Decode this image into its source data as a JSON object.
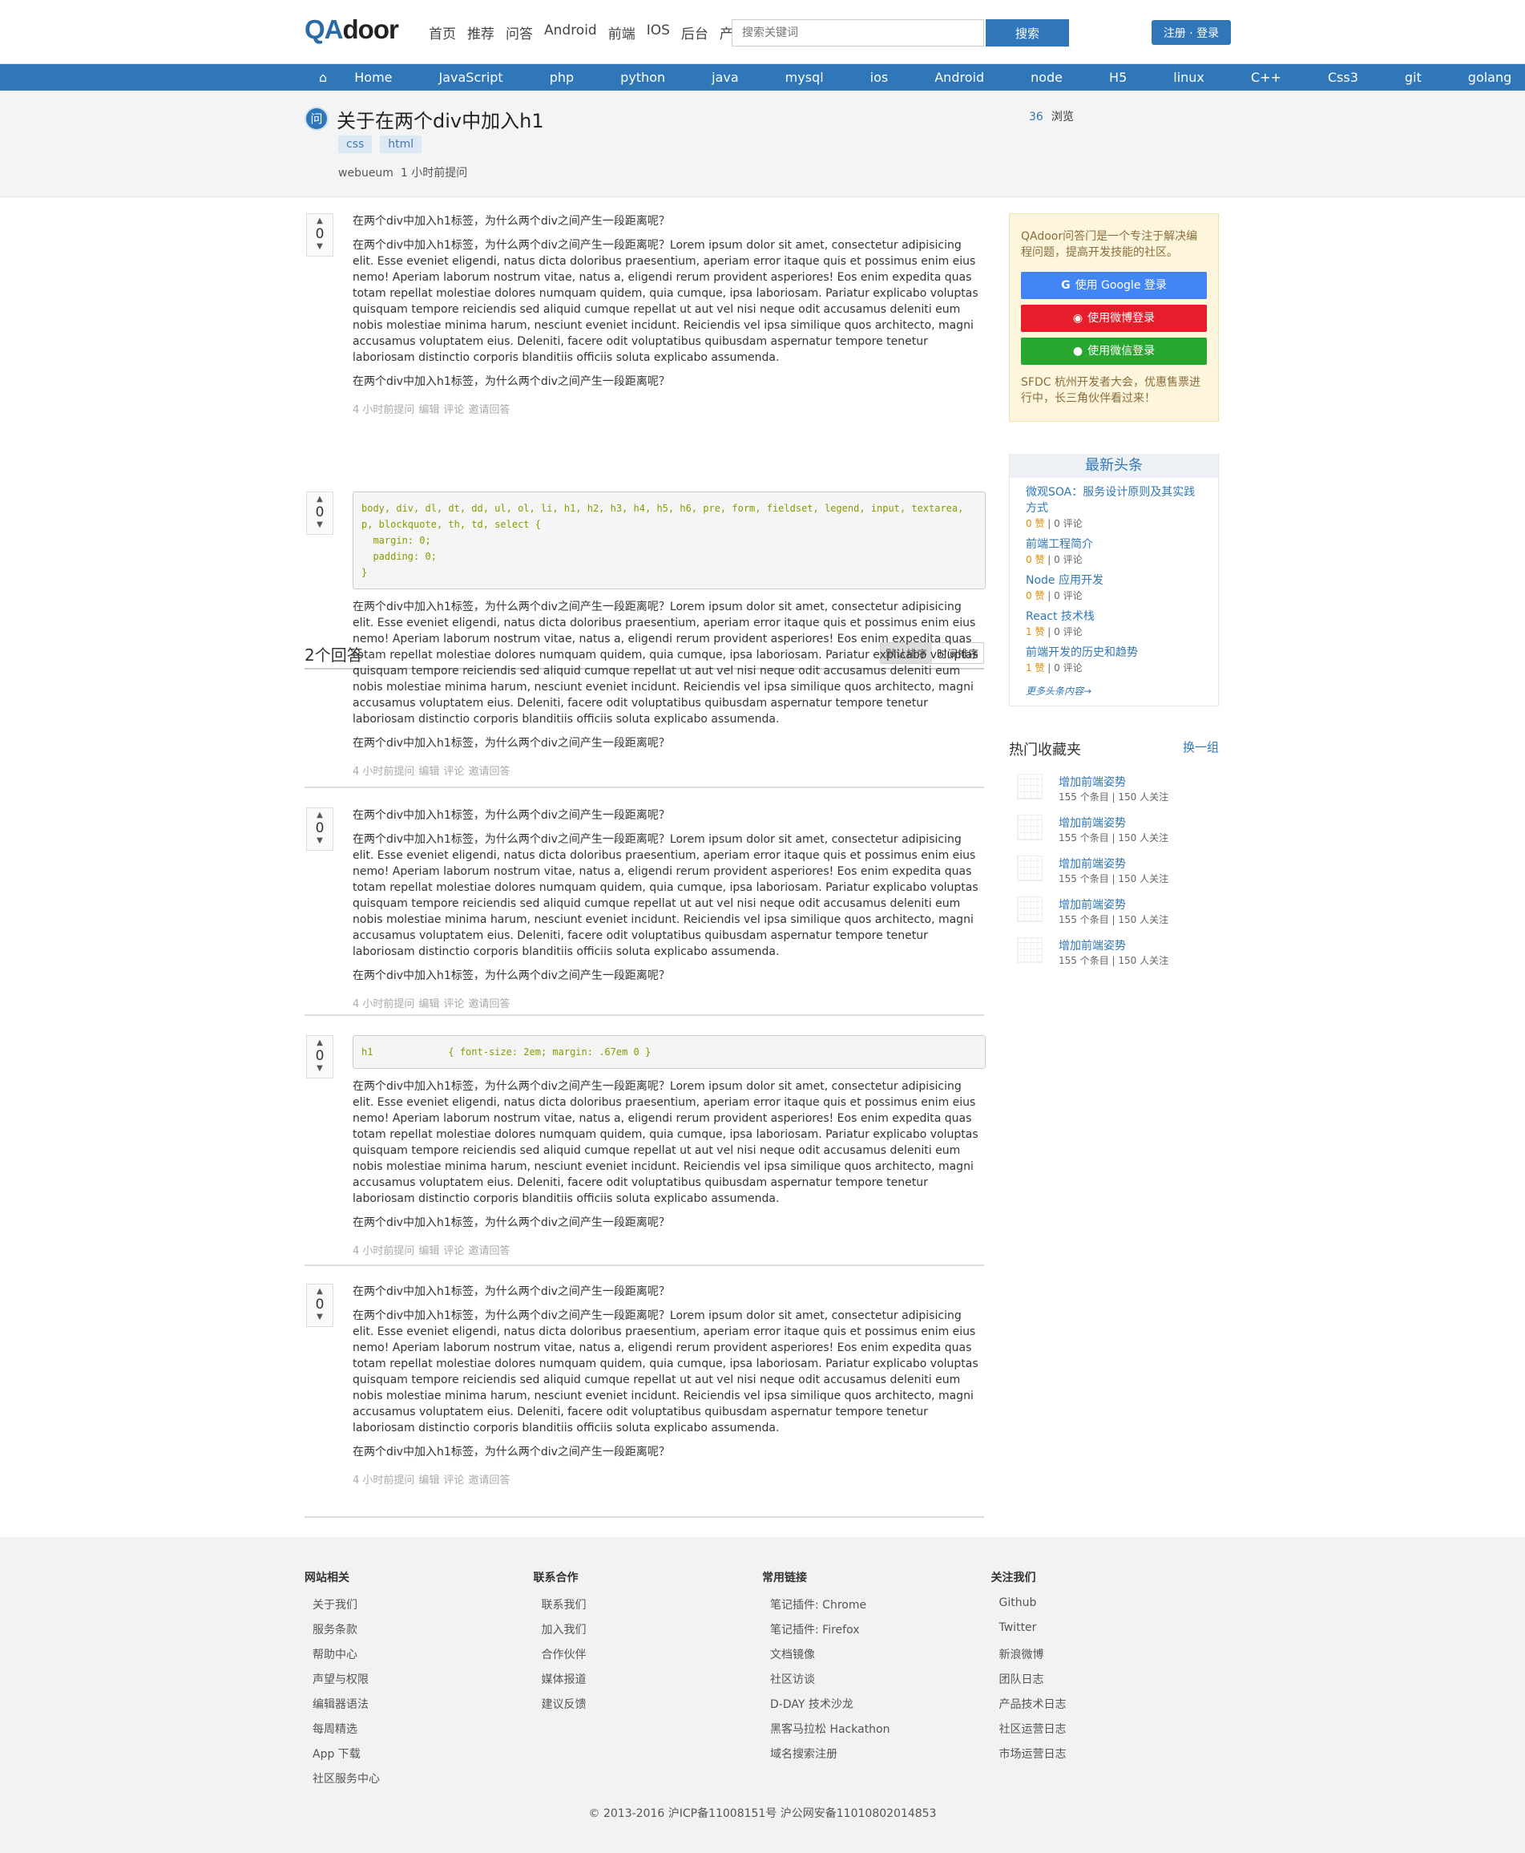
{
  "header": {
    "logo_qa": "QA",
    "logo_door": "door",
    "nav": [
      "首页",
      "推荐",
      "问答",
      "Android",
      "前端",
      "IOS",
      "后台",
      "产品"
    ],
    "search_placeholder": "搜索关键词",
    "search_btn": "搜索",
    "login_btn": "注册 · 登录"
  },
  "categories": [
    "Home",
    "JavaScript",
    "php",
    "python",
    "java",
    "mysql",
    "ios",
    "Android",
    "node",
    "H5",
    "linux",
    "C++",
    "Css3",
    "git",
    "golang",
    ">>"
  ],
  "question": {
    "icon": "问",
    "title": "关于在两个div中加入h1",
    "tags": [
      "css",
      "html"
    ],
    "author": "webueum",
    "time": "1 小时前提问",
    "views": "36",
    "views_label": "浏览",
    "vote": "0",
    "line1": "在两个div中加入h1标签，为什么两个div之间产生一段距离呢？",
    "body": "在两个div中加入h1标签，为什么两个div之间产生一段距离呢？Lorem ipsum dolor sit amet, consectetur adipisicing elit. Esse eveniet eligendi, natus dicta doloribus praesentium, aperiam error itaque quis et possimus enim eius nemo! Aperiam laborum nostrum vitae, natus a, eligendi rerum provident asperiores! Eos enim expedita quas totam repellat molestiae dolores numquam quidem, quia cumque, ipsa laboriosam. Pariatur explicabo voluptas quisquam tempore reiciendis sed aliquid cumque repellat ut aut vel nisi neque odit accusamus deleniti eum nobis molestiae minima harum, nesciunt eveniet incidunt. Reiciendis vel ipsa similique quos architecto, magni accusamus voluptatem eius. Deleniti, facere odit voluptatibus quibusdam aspernatur tempore tenetur laboriosam distinctio corporis blanditiis officiis soluta explicabo assumenda.",
    "line3": "在两个div中加入h1标签，为什么两个div之间产生一段距离呢？",
    "meta": [
      "4 小时前提问",
      "编辑",
      "评论",
      "邀请回答"
    ]
  },
  "answers_header": {
    "title": "2个回答",
    "sort_default": "默认排序",
    "sort_time": "时间排序"
  },
  "answers": [
    {
      "vote": "0",
      "code": "body, div, dl, dt, dd, ul, ol, li, h1, h2, h3, h4, h5, h6, pre, form, fieldset, legend, input, textarea, p, blockquote, th, td, select {\n  margin: 0;\n  padding: 0;\n}",
      "line1": "",
      "body": "在两个div中加入h1标签，为什么两个div之间产生一段距离呢？Lorem ipsum dolor sit amet, consectetur adipisicing elit. Esse eveniet eligendi, natus dicta doloribus praesentium, aperiam error itaque quis et possimus enim eius nemo! Aperiam laborum nostrum vitae, natus a, eligendi rerum provident asperiores! Eos enim expedita quas totam repellat molestiae dolores numquam quidem, quia cumque, ipsa laboriosam. Pariatur explicabo voluptas quisquam tempore reiciendis sed aliquid cumque repellat ut aut vel nisi neque odit accusamus deleniti eum nobis molestiae minima harum, nesciunt eveniet incidunt. Reiciendis vel ipsa similique quos architecto, magni accusamus voluptatem eius. Deleniti, facere odit voluptatibus quibusdam aspernatur tempore tenetur laboriosam distinctio corporis blanditiis officiis soluta explicabo assumenda.",
      "line3": "在两个div中加入h1标签，为什么两个div之间产生一段距离呢？",
      "meta": [
        "4 小时前提问",
        "编辑",
        "评论",
        "邀请回答"
      ]
    },
    {
      "vote": "0",
      "code": "",
      "line1": "在两个div中加入h1标签，为什么两个div之间产生一段距离呢？",
      "body": "在两个div中加入h1标签，为什么两个div之间产生一段距离呢？Lorem ipsum dolor sit amet, consectetur adipisicing elit. Esse eveniet eligendi, natus dicta doloribus praesentium, aperiam error itaque quis et possimus enim eius nemo! Aperiam laborum nostrum vitae, natus a, eligendi rerum provident asperiores! Eos enim expedita quas totam repellat molestiae dolores numquam quidem, quia cumque, ipsa laboriosam. Pariatur explicabo voluptas quisquam tempore reiciendis sed aliquid cumque repellat ut aut vel nisi neque odit accusamus deleniti eum nobis molestiae minima harum, nesciunt eveniet incidunt. Reiciendis vel ipsa similique quos architecto, magni accusamus voluptatem eius. Deleniti, facere odit voluptatibus quibusdam aspernatur tempore tenetur laboriosam distinctio corporis blanditiis officiis soluta explicabo assumenda.",
      "line3": "在两个div中加入h1标签，为什么两个div之间产生一段距离呢？",
      "meta": [
        "4 小时前提问",
        "编辑",
        "评论",
        "邀请回答"
      ]
    },
    {
      "vote": "0",
      "code": "h1             { font-size: 2em; margin: .67em 0 }",
      "line1": "",
      "body": "在两个div中加入h1标签，为什么两个div之间产生一段距离呢？Lorem ipsum dolor sit amet, consectetur adipisicing elit. Esse eveniet eligendi, natus dicta doloribus praesentium, aperiam error itaque quis et possimus enim eius nemo! Aperiam laborum nostrum vitae, natus a, eligendi rerum provident asperiores! Eos enim expedita quas totam repellat molestiae dolores numquam quidem, quia cumque, ipsa laboriosam. Pariatur explicabo voluptas quisquam tempore reiciendis sed aliquid cumque repellat ut aut vel nisi neque odit accusamus deleniti eum nobis molestiae minima harum, nesciunt eveniet incidunt. Reiciendis vel ipsa similique quos architecto, magni accusamus voluptatem eius. Deleniti, facere odit voluptatibus quibusdam aspernatur tempore tenetur laboriosam distinctio corporis blanditiis officiis soluta explicabo assumenda.",
      "line3": "在两个div中加入h1标签，为什么两个div之间产生一段距离呢？",
      "meta": [
        "4 小时前提问",
        "编辑",
        "评论",
        "邀请回答"
      ]
    },
    {
      "vote": "0",
      "code": "",
      "line1": "在两个div中加入h1标签，为什么两个div之间产生一段距离呢？",
      "body": "在两个div中加入h1标签，为什么两个div之间产生一段距离呢？Lorem ipsum dolor sit amet, consectetur adipisicing elit. Esse eveniet eligendi, natus dicta doloribus praesentium, aperiam error itaque quis et possimus enim eius nemo! Aperiam laborum nostrum vitae, natus a, eligendi rerum provident asperiores! Eos enim expedita quas totam repellat molestiae dolores numquam quidem, quia cumque, ipsa laboriosam. Pariatur explicabo voluptas quisquam tempore reiciendis sed aliquid cumque repellat ut aut vel nisi neque odit accusamus deleniti eum nobis molestiae minima harum, nesciunt eveniet incidunt. Reiciendis vel ipsa similique quos architecto, magni accusamus voluptatem eius. Deleniti, facere odit voluptatibus quibusdam aspernatur tempore tenetur laboriosam distinctio corporis blanditiis officiis soluta explicabo assumenda.",
      "line3": "在两个div中加入h1标签，为什么两个div之间产生一段距离呢？",
      "meta": [
        "4 小时前提问",
        "编辑",
        "评论",
        "邀请回答"
      ]
    }
  ],
  "sidebar": {
    "intro": "QAdoor问答门是一个专注于解决编程问题，提高开发技能的社区。",
    "google": "使用 Google 登录",
    "weibo": "使用微博登录",
    "wechat": "使用微信登录",
    "promo": "SFDC 杭州开发者大会，优惠售票进行中，长三角伙伴看过来！",
    "news_title": "最新头条",
    "news": [
      {
        "title": "微观SOA：服务设计原则及其实践方式",
        "likes": "0 赞",
        "comments": "0 评论"
      },
      {
        "title": "前端工程简介",
        "likes": "0 赞",
        "comments": "0 评论"
      },
      {
        "title": "Node 应用开发",
        "likes": "0 赞",
        "comments": "0 评论"
      },
      {
        "title": "React 技术栈",
        "likes": "1 赞",
        "comments": "0 评论"
      },
      {
        "title": "前端开发的历史和趋势",
        "likes": "1 赞",
        "comments": "0 评论"
      }
    ],
    "news_more": "更多头条内容→",
    "fav_title": "热门收藏夹",
    "fav_change": "换一组",
    "favs": [
      {
        "title": "增加前端姿势",
        "stats": "155 个条目 | 150 人关注"
      },
      {
        "title": "增加前端姿势",
        "stats": "155 个条目 | 150 人关注"
      },
      {
        "title": "增加前端姿势",
        "stats": "155 个条目 | 150 人关注"
      },
      {
        "title": "增加前端姿势",
        "stats": "155 个条目 | 150 人关注"
      },
      {
        "title": "增加前端姿势",
        "stats": "155 个条目 | 150 人关注"
      }
    ]
  },
  "footer": {
    "cols": [
      {
        "title": "网站相关",
        "items": [
          "关于我们",
          "服务条款",
          "帮助中心",
          "声望与权限",
          "编辑器语法",
          "每周精选",
          "App 下载",
          "社区服务中心"
        ]
      },
      {
        "title": "联系合作",
        "items": [
          "联系我们",
          "加入我们",
          "合作伙伴",
          "媒体报道",
          "建议反馈"
        ]
      },
      {
        "title": "常用链接",
        "items": [
          "笔记插件: Chrome",
          "笔记插件: Firefox",
          "文档镜像",
          "社区访谈",
          "D-DAY 技术沙龙",
          "黑客马拉松 Hackathon",
          "域名搜索注册"
        ]
      },
      {
        "title": "关注我们",
        "items": [
          "Github",
          "Twitter",
          "新浪微博",
          "团队日志",
          "产品技术日志",
          "社区运营日志",
          "市场运营日志"
        ]
      }
    ],
    "copyright": "© 2013-2016 沪ICP备11008151号 沪公网安备11010802014853"
  }
}
